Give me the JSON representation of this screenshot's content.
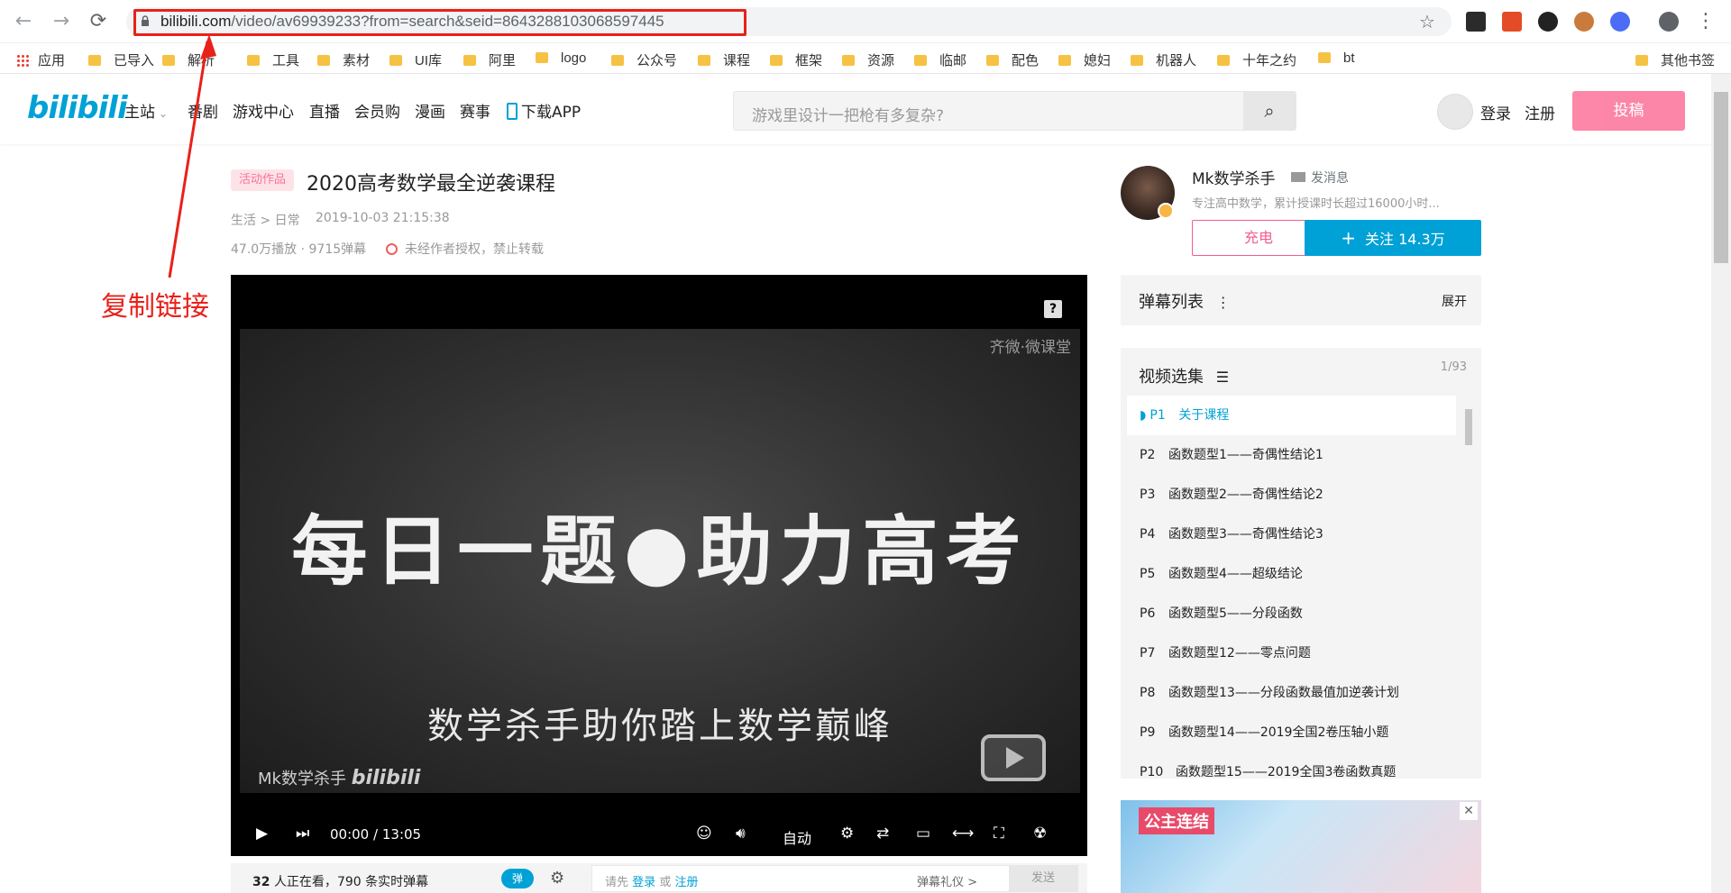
{
  "browser": {
    "url_host": "bilibili.com",
    "url_path": "/video/av69939233?from=search&seid=8643288103068597445",
    "bookmarks": [
      "应用",
      "已导入",
      "解析",
      "工具",
      "素材",
      "UI库",
      "阿里",
      "logo",
      "公众号",
      "课程",
      "框架",
      "资源",
      "临邮",
      "配色",
      "媳妇",
      "机器人",
      "十年之约",
      "bt",
      "其他书签"
    ]
  },
  "annotation": {
    "label": "复制链接",
    "color": "#e8211a"
  },
  "header": {
    "logo": "bilibili",
    "nav": [
      "主站",
      "番剧",
      "游戏中心",
      "直播",
      "会员购",
      "漫画",
      "赛事",
      "下载APP"
    ],
    "search_placeholder": "游戏里设计一把枪有多复杂?",
    "login": "登录",
    "register": "注册",
    "upload": "投稿"
  },
  "video": {
    "tag": "活动作品",
    "title": "2020高考数学最全逆袭课程",
    "category": "生活 > 日常",
    "date": "2019-10-03 21:15:38",
    "stats": "47.0万播放 · 9715弹幕",
    "copyright": "未经作者授权，禁止转载"
  },
  "player": {
    "board_title": "每日一题●助力高考",
    "board_subtitle": "数学杀手助你踏上数学巅峰",
    "watermark_top": "齐微·微课堂",
    "watermark_author": "Mk数学杀手",
    "watermark_brand": "bilibili",
    "time_current": "00:00",
    "time_sep": "/",
    "time_total": "13:05",
    "quality": "自动",
    "help": "?"
  },
  "danmaku_bar": {
    "watching_count": "32",
    "watching_text": "人正在看，",
    "realtime": "790 条实时弹幕",
    "toggle": "弹",
    "input_prefix": "请先",
    "input_login": "登录",
    "input_or": "或",
    "input_register": "注册",
    "etiquette": "弹幕礼仪 >",
    "send": "发送"
  },
  "uploader": {
    "name": "Mk数学杀手",
    "message": "发消息",
    "desc": "专注高中数学，累计授课时长超过16000小时...",
    "charge": "充电",
    "follow": "关注 14.3万"
  },
  "danmaku_list": {
    "title": "弹幕列表",
    "expand": "展开"
  },
  "episodes": {
    "title": "视频选集",
    "count": "1/93",
    "items": [
      {
        "num": "P1",
        "title": "关于课程"
      },
      {
        "num": "P2",
        "title": "函数题型1——奇偶性结论1"
      },
      {
        "num": "P3",
        "title": "函数题型2——奇偶性结论2"
      },
      {
        "num": "P4",
        "title": "函数题型3——奇偶性结论3"
      },
      {
        "num": "P5",
        "title": "函数题型4——超级结论"
      },
      {
        "num": "P6",
        "title": "函数题型5——分段函数"
      },
      {
        "num": "P7",
        "title": "函数题型12——零点问题"
      },
      {
        "num": "P8",
        "title": "函数题型13——分段函数最值加逆袭计划"
      },
      {
        "num": "P9",
        "title": "函数题型14——2019全国2卷压轴小题"
      },
      {
        "num": "P10",
        "title": "函数题型15——2019全国3卷函数真题"
      }
    ]
  },
  "ad": {
    "title": "公主连结",
    "close": "✕"
  },
  "colors": {
    "bili_blue": "#00a1d6",
    "bili_pink": "#fb7299",
    "annotation_red": "#e8211a"
  }
}
